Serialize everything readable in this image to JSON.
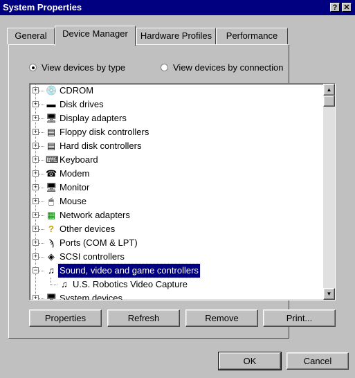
{
  "window": {
    "title": "System Properties",
    "help_glyph": "?",
    "close_glyph": "✕"
  },
  "tabs": [
    {
      "label": "General"
    },
    {
      "label": "Device Manager"
    },
    {
      "label": "Hardware Profiles"
    },
    {
      "label": "Performance"
    }
  ],
  "view_options": {
    "by_type": "View devices by type",
    "by_connection": "View devices by connection",
    "selected": "by_type"
  },
  "tree": {
    "items": [
      {
        "label": "CDROM",
        "icon": "cdrom-icon",
        "expander": "+"
      },
      {
        "label": "Disk drives",
        "icon": "disk-drive-icon",
        "expander": "+"
      },
      {
        "label": "Display adapters",
        "icon": "monitor-icon",
        "expander": "+"
      },
      {
        "label": "Floppy disk controllers",
        "icon": "floppy-controller-icon",
        "expander": "+"
      },
      {
        "label": "Hard disk controllers",
        "icon": "hard-disk-controller-icon",
        "expander": "+"
      },
      {
        "label": "Keyboard",
        "icon": "keyboard-icon",
        "expander": "+"
      },
      {
        "label": "Modem",
        "icon": "modem-icon",
        "expander": "+"
      },
      {
        "label": "Monitor",
        "icon": "monitor-icon",
        "expander": "+"
      },
      {
        "label": "Mouse",
        "icon": "mouse-icon",
        "expander": "+"
      },
      {
        "label": "Network adapters",
        "icon": "network-adapter-icon",
        "expander": "+"
      },
      {
        "label": "Other devices",
        "icon": "question-icon",
        "expander": "+"
      },
      {
        "label": "Ports (COM & LPT)",
        "icon": "port-icon",
        "expander": "+"
      },
      {
        "label": "SCSI controllers",
        "icon": "scsi-icon",
        "expander": "+"
      },
      {
        "label": "Sound, video and game controllers",
        "icon": "sound-icon",
        "expander": "−",
        "selected": true
      },
      {
        "label": "U.S. Robotics Video Capture",
        "icon": "sound-icon",
        "child": true
      },
      {
        "label": "System devices",
        "icon": "system-devices-icon",
        "expander": "+"
      }
    ]
  },
  "buttons": {
    "properties": "Properties",
    "refresh": "Refresh",
    "remove": "Remove",
    "print": "Print...",
    "ok": "OK",
    "cancel": "Cancel"
  },
  "scrollbar": {
    "up": "▲",
    "down": "▼"
  }
}
